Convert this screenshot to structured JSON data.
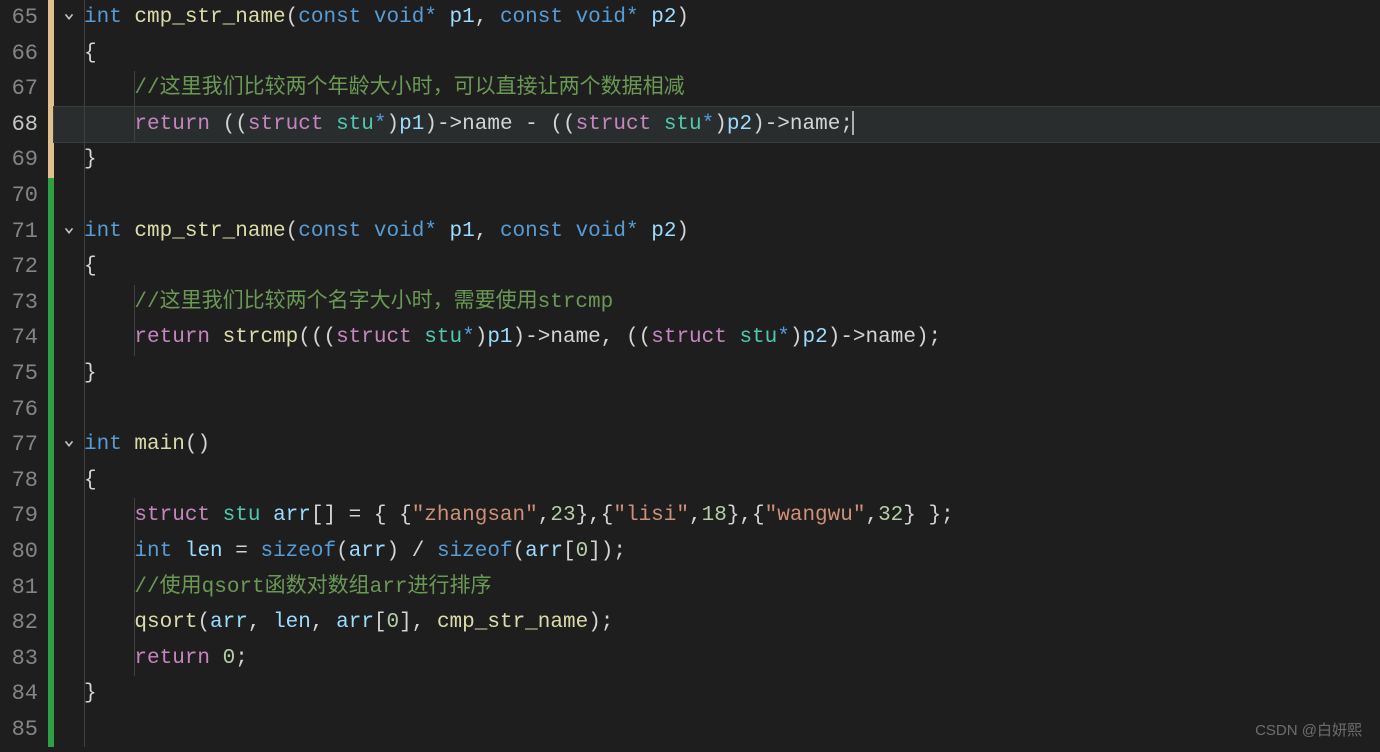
{
  "watermark": "CSDN @白妍熙",
  "firstLineNumber": 65,
  "activeLineNumber": 68,
  "lines": [
    {
      "num": "65",
      "fold": true,
      "tokens": [
        {
          "t": "int ",
          "c": "tok-type"
        },
        {
          "t": "cmp_str_name",
          "c": "tok-fn"
        },
        {
          "t": "(",
          "c": "tok-punc"
        },
        {
          "t": "const ",
          "c": "tok-type"
        },
        {
          "t": "void",
          "c": "tok-type"
        },
        {
          "t": "*",
          "c": "tok-star"
        },
        {
          "t": " p1",
          "c": "tok-id"
        },
        {
          "t": ", ",
          "c": "tok-punc"
        },
        {
          "t": "const ",
          "c": "tok-type"
        },
        {
          "t": "void",
          "c": "tok-type"
        },
        {
          "t": "*",
          "c": "tok-star"
        },
        {
          "t": " p2",
          "c": "tok-id"
        },
        {
          "t": ")",
          "c": "tok-punc"
        }
      ]
    },
    {
      "num": "66",
      "tokens": [
        {
          "t": "{",
          "c": "tok-punc"
        }
      ]
    },
    {
      "num": "67",
      "indent": 1,
      "tokens": [
        {
          "t": "//这里我们比较两个年龄大小时，可以直接让两个数据相减",
          "c": "tok-comment"
        }
      ]
    },
    {
      "num": "68",
      "indent": 1,
      "highlight": true,
      "tokens": [
        {
          "t": "return ",
          "c": "tok-kw2"
        },
        {
          "t": "((",
          "c": "tok-punc"
        },
        {
          "t": "struct ",
          "c": "tok-struct"
        },
        {
          "t": "stu",
          "c": "tok-struct-name"
        },
        {
          "t": "*",
          "c": "tok-star"
        },
        {
          "t": ")",
          "c": "tok-punc"
        },
        {
          "t": "p1",
          "c": "tok-id"
        },
        {
          "t": ")",
          "c": "tok-punc"
        },
        {
          "t": "->",
          "c": "tok-op"
        },
        {
          "t": "name ",
          "c": "tok-plain"
        },
        {
          "t": "- ",
          "c": "tok-op"
        },
        {
          "t": "((",
          "c": "tok-punc"
        },
        {
          "t": "struct ",
          "c": "tok-struct"
        },
        {
          "t": "stu",
          "c": "tok-struct-name"
        },
        {
          "t": "*",
          "c": "tok-star"
        },
        {
          "t": ")",
          "c": "tok-punc"
        },
        {
          "t": "p2",
          "c": "tok-id"
        },
        {
          "t": ")",
          "c": "tok-punc"
        },
        {
          "t": "->",
          "c": "tok-op"
        },
        {
          "t": "name",
          "c": "tok-plain"
        },
        {
          "t": ";",
          "c": "tok-punc"
        }
      ],
      "cursor": true
    },
    {
      "num": "69",
      "tokens": [
        {
          "t": "}",
          "c": "tok-punc"
        }
      ]
    },
    {
      "num": "70",
      "tokens": []
    },
    {
      "num": "71",
      "fold": true,
      "tokens": [
        {
          "t": "int ",
          "c": "tok-type"
        },
        {
          "t": "cmp_str_name",
          "c": "tok-fn"
        },
        {
          "t": "(",
          "c": "tok-punc"
        },
        {
          "t": "const ",
          "c": "tok-type"
        },
        {
          "t": "void",
          "c": "tok-type"
        },
        {
          "t": "*",
          "c": "tok-star"
        },
        {
          "t": " p1",
          "c": "tok-id"
        },
        {
          "t": ", ",
          "c": "tok-punc"
        },
        {
          "t": "const ",
          "c": "tok-type"
        },
        {
          "t": "void",
          "c": "tok-type"
        },
        {
          "t": "*",
          "c": "tok-star"
        },
        {
          "t": " p2",
          "c": "tok-id"
        },
        {
          "t": ")",
          "c": "tok-punc"
        }
      ]
    },
    {
      "num": "72",
      "tokens": [
        {
          "t": "{",
          "c": "tok-punc"
        }
      ]
    },
    {
      "num": "73",
      "indent": 1,
      "tokens": [
        {
          "t": "//这里我们比较两个名字大小时，需要使用strcmp",
          "c": "tok-comment"
        }
      ]
    },
    {
      "num": "74",
      "indent": 1,
      "tokens": [
        {
          "t": "return ",
          "c": "tok-kw2"
        },
        {
          "t": "strcmp",
          "c": "tok-fn"
        },
        {
          "t": "(((",
          "c": "tok-punc"
        },
        {
          "t": "struct ",
          "c": "tok-struct"
        },
        {
          "t": "stu",
          "c": "tok-struct-name"
        },
        {
          "t": "*",
          "c": "tok-star"
        },
        {
          "t": ")",
          "c": "tok-punc"
        },
        {
          "t": "p1",
          "c": "tok-id"
        },
        {
          "t": ")",
          "c": "tok-punc"
        },
        {
          "t": "->",
          "c": "tok-op"
        },
        {
          "t": "name",
          "c": "tok-plain"
        },
        {
          "t": ", ",
          "c": "tok-punc"
        },
        {
          "t": "((",
          "c": "tok-punc"
        },
        {
          "t": "struct ",
          "c": "tok-struct"
        },
        {
          "t": "stu",
          "c": "tok-struct-name"
        },
        {
          "t": "*",
          "c": "tok-star"
        },
        {
          "t": ")",
          "c": "tok-punc"
        },
        {
          "t": "p2",
          "c": "tok-id"
        },
        {
          "t": ")",
          "c": "tok-punc"
        },
        {
          "t": "->",
          "c": "tok-op"
        },
        {
          "t": "name",
          "c": "tok-plain"
        },
        {
          "t": ");",
          "c": "tok-punc"
        }
      ]
    },
    {
      "num": "75",
      "tokens": [
        {
          "t": "}",
          "c": "tok-punc"
        }
      ]
    },
    {
      "num": "76",
      "tokens": []
    },
    {
      "num": "77",
      "fold": true,
      "tokens": [
        {
          "t": "int ",
          "c": "tok-type"
        },
        {
          "t": "main",
          "c": "tok-fn"
        },
        {
          "t": "()",
          "c": "tok-punc"
        }
      ]
    },
    {
      "num": "78",
      "tokens": [
        {
          "t": "{",
          "c": "tok-punc"
        }
      ]
    },
    {
      "num": "79",
      "indent": 1,
      "tokens": [
        {
          "t": "struct ",
          "c": "tok-struct"
        },
        {
          "t": "stu ",
          "c": "tok-struct-name"
        },
        {
          "t": "arr",
          "c": "tok-id"
        },
        {
          "t": "[] = { {",
          "c": "tok-punc"
        },
        {
          "t": "\"zhangsan\"",
          "c": "tok-str"
        },
        {
          "t": ",",
          "c": "tok-punc"
        },
        {
          "t": "23",
          "c": "tok-num"
        },
        {
          "t": "},{",
          "c": "tok-punc"
        },
        {
          "t": "\"lisi\"",
          "c": "tok-str"
        },
        {
          "t": ",",
          "c": "tok-punc"
        },
        {
          "t": "18",
          "c": "tok-num"
        },
        {
          "t": "},{",
          "c": "tok-punc"
        },
        {
          "t": "\"wangwu\"",
          "c": "tok-str"
        },
        {
          "t": ",",
          "c": "tok-punc"
        },
        {
          "t": "32",
          "c": "tok-num"
        },
        {
          "t": "} };",
          "c": "tok-punc"
        }
      ]
    },
    {
      "num": "80",
      "indent": 1,
      "tokens": [
        {
          "t": "int ",
          "c": "tok-type"
        },
        {
          "t": "len",
          "c": "tok-id"
        },
        {
          "t": " = ",
          "c": "tok-op"
        },
        {
          "t": "sizeof",
          "c": "tok-type"
        },
        {
          "t": "(",
          "c": "tok-punc"
        },
        {
          "t": "arr",
          "c": "tok-id"
        },
        {
          "t": ") / ",
          "c": "tok-punc"
        },
        {
          "t": "sizeof",
          "c": "tok-type"
        },
        {
          "t": "(",
          "c": "tok-punc"
        },
        {
          "t": "arr",
          "c": "tok-id"
        },
        {
          "t": "[",
          "c": "tok-punc"
        },
        {
          "t": "0",
          "c": "tok-num"
        },
        {
          "t": "]);",
          "c": "tok-punc"
        }
      ]
    },
    {
      "num": "81",
      "indent": 1,
      "tokens": [
        {
          "t": "//使用qsort函数对数组arr进行排序",
          "c": "tok-comment"
        }
      ]
    },
    {
      "num": "82",
      "indent": 1,
      "tokens": [
        {
          "t": "qsort",
          "c": "tok-fn"
        },
        {
          "t": "(",
          "c": "tok-punc"
        },
        {
          "t": "arr",
          "c": "tok-id"
        },
        {
          "t": ", ",
          "c": "tok-punc"
        },
        {
          "t": "len",
          "c": "tok-id"
        },
        {
          "t": ", ",
          "c": "tok-punc"
        },
        {
          "t": "arr",
          "c": "tok-id"
        },
        {
          "t": "[",
          "c": "tok-punc"
        },
        {
          "t": "0",
          "c": "tok-num"
        },
        {
          "t": "], ",
          "c": "tok-punc"
        },
        {
          "t": "cmp_str_name",
          "c": "tok-fn"
        },
        {
          "t": ");",
          "c": "tok-punc"
        }
      ]
    },
    {
      "num": "83",
      "indent": 1,
      "tokens": [
        {
          "t": "return ",
          "c": "tok-kw2"
        },
        {
          "t": "0",
          "c": "tok-num"
        },
        {
          "t": ";",
          "c": "tok-punc"
        }
      ]
    },
    {
      "num": "84",
      "tokens": [
        {
          "t": "}",
          "c": "tok-punc"
        }
      ]
    },
    {
      "num": "85",
      "tokens": []
    }
  ],
  "changebar": [
    {
      "color": "yellow",
      "from": 65,
      "to": 69
    },
    {
      "color": "green",
      "from": 70,
      "to": 85
    }
  ]
}
